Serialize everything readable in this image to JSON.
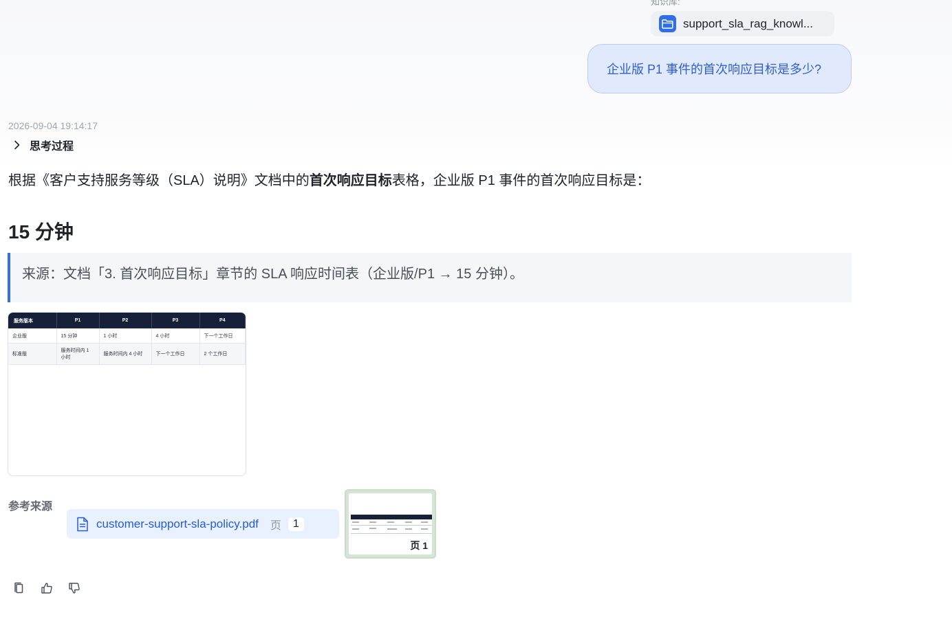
{
  "knowledge_base": {
    "label": "知识库:",
    "name": "support_sla_rag_knowl..."
  },
  "question": "企业版 P1 事件的首次响应目标是多少?",
  "answer": {
    "timestamp": "2026-09-04 19:14:17",
    "thinking_label": "思考过程",
    "intro_before": "根据《客户支持服务等级（SLA）说明》文档中的",
    "intro_bold": "首次响应目标",
    "intro_after": "表格，企业版 P1 事件的首次响应目标是：",
    "heading": "15 分钟",
    "quote": "来源：文档「3. 首次响应目标」章节的 SLA 响应时间表（企业版/P1 → 15 分钟）。"
  },
  "preview_table": {
    "headers": [
      "服务版本",
      "P1",
      "P2",
      "P3",
      "P4"
    ],
    "rows": [
      [
        "企业版",
        "15 分钟",
        "1 小时",
        "4 小时",
        "下一个工作日"
      ],
      [
        "标准版",
        "服务时间内 1 小时",
        "服务时间内 4 小时",
        "下一个工作日",
        "2 个工作日"
      ]
    ]
  },
  "sources": {
    "label": "参考来源",
    "file_name": "customer-support-sla-policy.pdf",
    "page_label": "页",
    "page_number": "1",
    "thumbnail_badge": "页 1"
  },
  "actions": [
    "copy-icon",
    "thumbs-up-icon",
    "thumbs-down-icon"
  ],
  "colors": {
    "accent": "#3370e8",
    "link": "#245bdb",
    "question_bg": "#e1e9fd",
    "table_header": "#162038"
  }
}
